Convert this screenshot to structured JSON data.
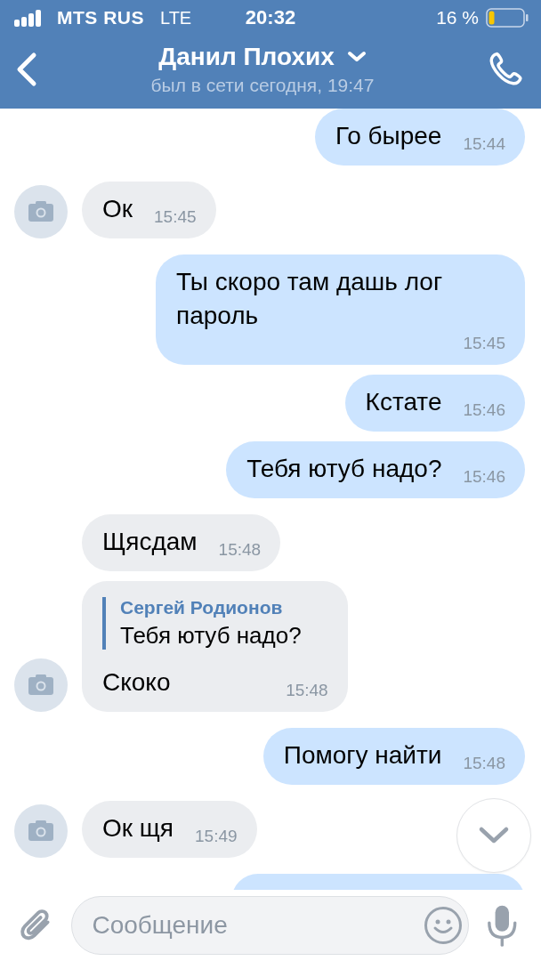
{
  "status_bar": {
    "carrier": "MTS RUS",
    "network": "LTE",
    "time": "20:32",
    "battery": "16 %"
  },
  "header": {
    "title": "Данил Плохих",
    "subtitle": "был в сети сегодня, 19:47"
  },
  "messages": [
    {
      "kind": "text",
      "outgoing": true,
      "text": "Го бырее",
      "time": "15:44"
    },
    {
      "kind": "text",
      "outgoing": false,
      "avatar": true,
      "text": "Ок",
      "time": "15:45"
    },
    {
      "kind": "text",
      "outgoing": true,
      "text": "Ты скоро там дашь лог пароль",
      "time": "15:45"
    },
    {
      "kind": "text",
      "outgoing": true,
      "text": "Кстате",
      "time": "15:46"
    },
    {
      "kind": "text",
      "outgoing": true,
      "text": "Тебя ютуб надо?",
      "time": "15:46"
    },
    {
      "kind": "text",
      "outgoing": false,
      "avatar": false,
      "text": "Щясдам",
      "time": "15:48"
    },
    {
      "kind": "reply",
      "outgoing": false,
      "avatar": true,
      "quote_author": "Сергей Родионов",
      "quote_text": "Тебя ютуб надо?",
      "text": "Скоко",
      "time": "15:48"
    },
    {
      "kind": "text",
      "outgoing": true,
      "text": "Помогу найти",
      "time": "15:48"
    },
    {
      "kind": "text",
      "outgoing": false,
      "avatar": true,
      "text": "Ок щя",
      "time": "15:49"
    },
    {
      "kind": "cut",
      "outgoing": true
    }
  ],
  "composer": {
    "placeholder": "Сообщение"
  }
}
